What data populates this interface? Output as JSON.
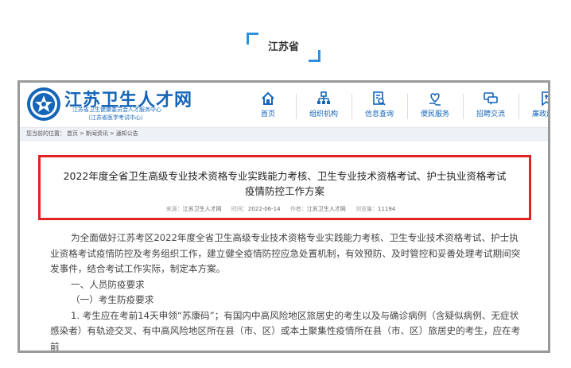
{
  "tag": {
    "label": "江苏省"
  },
  "site": {
    "title": "江苏卫生人才网",
    "subtitle1": "江苏省卫生健康委员会人才服务中心",
    "subtitle2": "（江苏省医学考试中心）"
  },
  "nav": {
    "items": [
      {
        "label": "首页",
        "icon": "home-icon"
      },
      {
        "label": "组织机构",
        "icon": "org-chart-icon"
      },
      {
        "label": "信息查询",
        "icon": "search-doc-icon"
      },
      {
        "label": "便民服务",
        "icon": "heart-hand-icon"
      },
      {
        "label": "招聘交流",
        "icon": "chat-icon"
      },
      {
        "label": "廉政建设",
        "icon": "bookmark-icon"
      }
    ]
  },
  "breadcrumb": {
    "prefix": "您当前的位置：",
    "items": [
      "首页",
      "新闻资讯",
      "通知公告"
    ],
    "separator": ">"
  },
  "article": {
    "title_line1": "2022年度全省卫生高级专业技术资格专业实践能力考核、卫生专业技术资格考试、护士执业资格考试",
    "title_line2": "疫情防控工作方案",
    "meta": {
      "source_label": "来源：",
      "source": "江苏卫生人才网",
      "time_label": "时间：",
      "time": "2022-06-14",
      "author_label": "作者：",
      "author": "江苏卫生人才网",
      "views_label": "浏览量：",
      "views": "11194"
    },
    "para1": "为全面做好江苏考区2022年度全省卫生高级专业技术资格专业实践能力考核、卫生专业技术资格考试、护士执业资格考试疫情防控及考务组织工作，建立健全疫情防控应急处置机制，有效预防、及时管控和妥善处理考试期间突发事件，结合考试工作实际，制定本方案。",
    "heading1": "一、人员防疫要求",
    "heading2": "（一）考生防疫要求",
    "para2": "1. 考生应在考前14天申领“苏康码”；有国内中高风险地区旅居史的考生以及与确诊病例（含疑似病例、无症状感染者）有轨迹交叉、有中高风险地区所在县（市、区）或本土聚集性疫情所在县（市、区）旅居史的考生，应在考前"
  }
}
